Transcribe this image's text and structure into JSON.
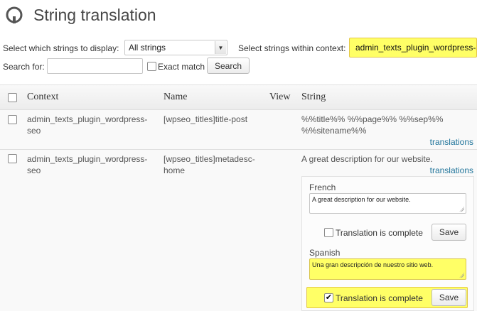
{
  "header": {
    "title": "String translation"
  },
  "filters": {
    "display_label": "Select which strings to display:",
    "display_value": "All strings",
    "context_label": "Select strings within context:",
    "context_value": "admin_texts_plugin_wordpress-seo",
    "search_label": "Search for:",
    "search_value": "",
    "exact_match_label": "Exact match",
    "exact_match_checked": false,
    "search_button": "Search"
  },
  "table": {
    "headers": {
      "context": "Context",
      "name": "Name",
      "view": "View",
      "string": "String"
    },
    "rows": [
      {
        "context_line1": "admin_texts_plugin_wordpress-",
        "context_line2": "seo",
        "name_line1": "[wpseo_titles]title-post",
        "name_line2": "",
        "string_line1": "%%title%% %%page%% %%sep%%",
        "string_line2": "%%sitename%%",
        "translations_link": "translations"
      },
      {
        "context_line1": "admin_texts_plugin_wordpress-",
        "context_line2": "seo",
        "name_line1": "[wpseo_titles]metadesc-",
        "name_line2": "home",
        "string_line1": "A great description for our website.",
        "translations_link": "translations",
        "translations": [
          {
            "language": "French",
            "text": "A great description for our website.",
            "complete_label": "Translation is complete",
            "complete": false,
            "save_label": "Save"
          },
          {
            "language": "Spanish",
            "text": "Una gran descripción de nuestro sitio web.",
            "complete_label": "Translation is complete",
            "complete": true,
            "save_label": "Save"
          }
        ]
      }
    ]
  },
  "colors": {
    "highlight": "#ffff66",
    "link": "#21759b"
  }
}
